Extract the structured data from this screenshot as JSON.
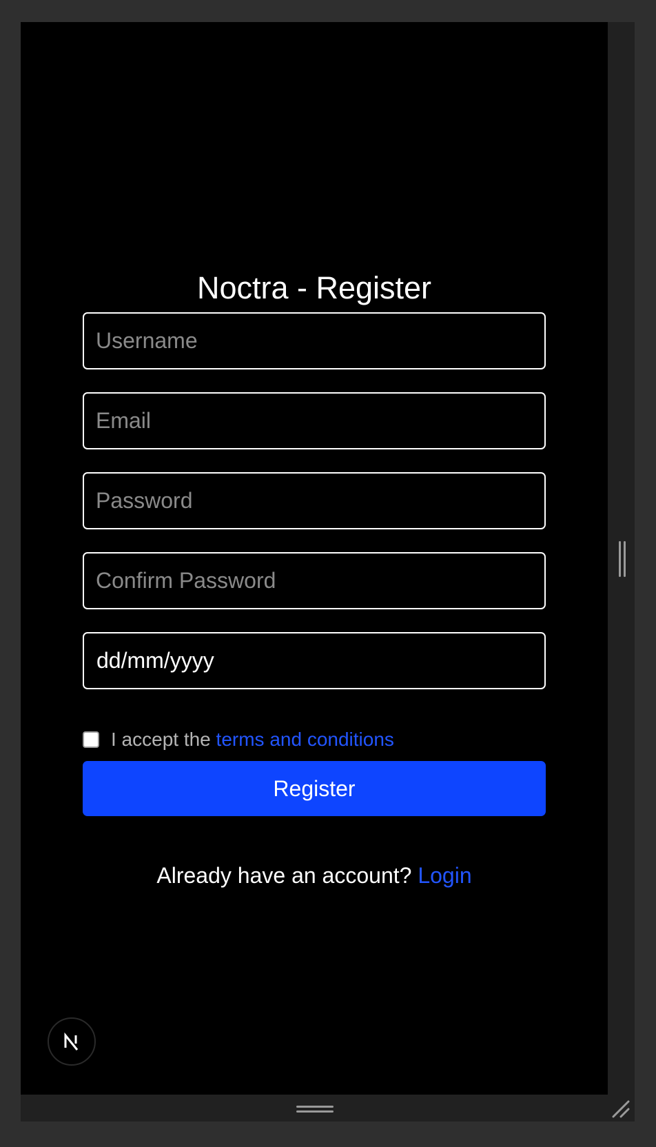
{
  "form": {
    "title": "Noctra - Register",
    "username_placeholder": "Username",
    "email_placeholder": "Email",
    "password_placeholder": "Password",
    "confirm_password_placeholder": "Confirm Password",
    "date_placeholder": "dd/mm/yyyy",
    "terms_prefix": "I accept the ",
    "terms_link": "terms and conditions",
    "terms_checked": false,
    "register_label": "Register",
    "login_prompt": "Already have an account? ",
    "login_link": "Login"
  },
  "badge": {
    "icon": "nextjs-logo-icon",
    "letter": "N"
  },
  "colors": {
    "background": "#000000",
    "accent": "#0e45ff",
    "link": "#2255ff",
    "field_border": "#ffffff",
    "placeholder": "#8a8a8a"
  }
}
